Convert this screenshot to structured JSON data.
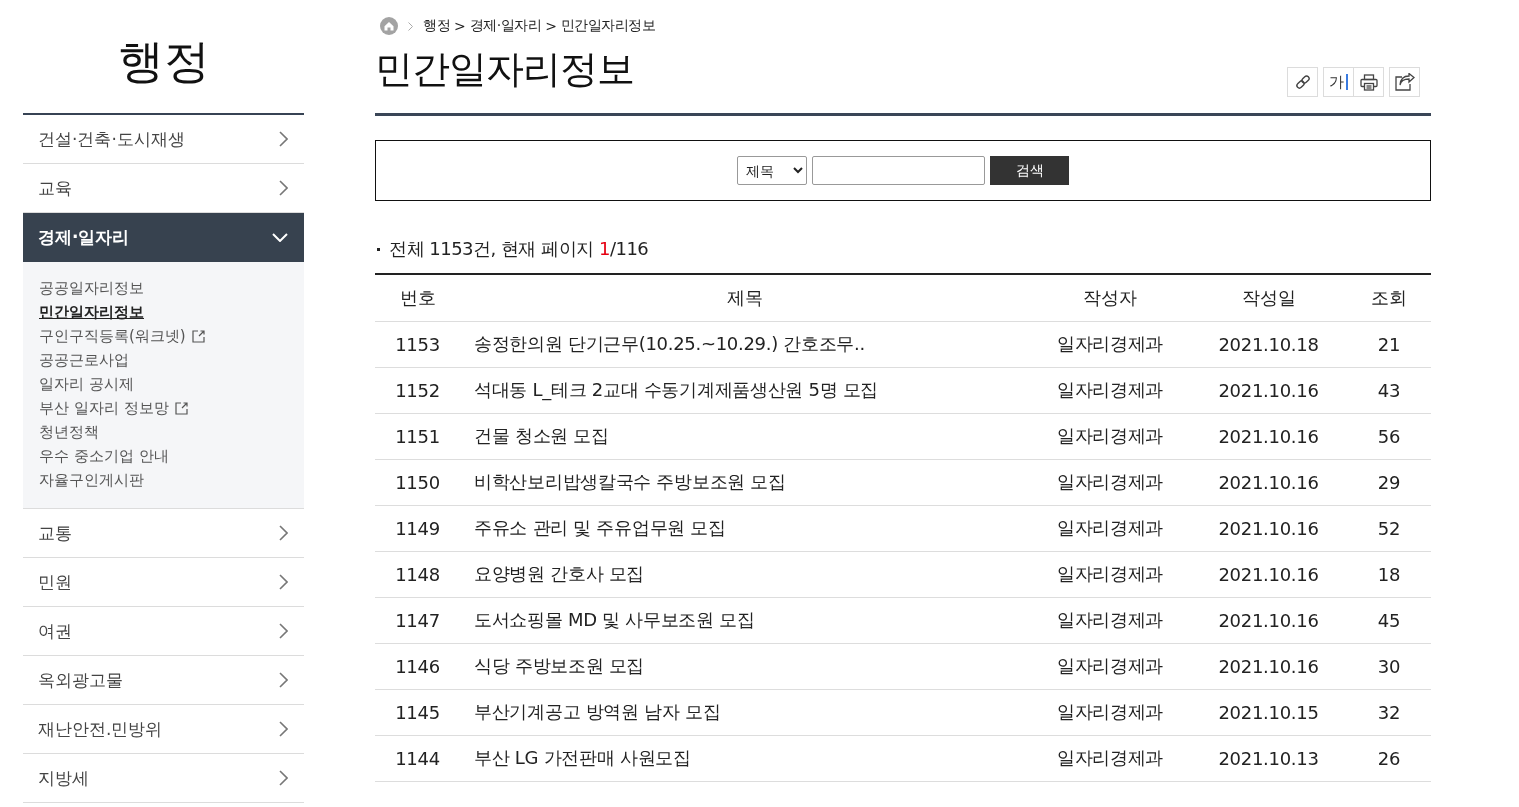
{
  "sidebar": {
    "title": "행정",
    "items": [
      {
        "label": "건설·건축·도시재생",
        "expanded": false
      },
      {
        "label": "교육",
        "expanded": false
      },
      {
        "label": "경제·일자리",
        "expanded": true,
        "children": [
          {
            "label": "공공일자리정보",
            "selected": false,
            "external_link": false
          },
          {
            "label": "민간일자리정보",
            "selected": true,
            "external_link": false
          },
          {
            "label": "구인구직등록(워크넷)",
            "selected": false,
            "external_link": true
          },
          {
            "label": "공공근로사업",
            "selected": false,
            "external_link": false
          },
          {
            "label": "일자리 공시제",
            "selected": false,
            "external_link": false
          },
          {
            "label": "부산 일자리 정보망",
            "selected": false,
            "external_link": true
          },
          {
            "label": "청년정책",
            "selected": false,
            "external_link": false
          },
          {
            "label": "우수 중소기업 안내",
            "selected": false,
            "external_link": false
          },
          {
            "label": "자율구인게시판",
            "selected": false,
            "external_link": false
          }
        ]
      },
      {
        "label": "교통",
        "expanded": false
      },
      {
        "label": "민원",
        "expanded": false
      },
      {
        "label": "여권",
        "expanded": false
      },
      {
        "label": "옥외광고물",
        "expanded": false
      },
      {
        "label": "재난안전.민방위",
        "expanded": false
      },
      {
        "label": "지방세",
        "expanded": false
      }
    ]
  },
  "breadcrumb": [
    {
      "kind": "home"
    },
    {
      "kind": "link",
      "text": "행정"
    },
    {
      "kind": "separator",
      "text": ">"
    },
    {
      "kind": "link",
      "text": "경제·일자리"
    },
    {
      "kind": "separator",
      "text": ">"
    },
    {
      "kind": "link",
      "text": "민간일자리정보"
    }
  ],
  "page_title": "민간일자리정보",
  "tools": [
    {
      "kind": "link"
    },
    {
      "kind": "font_size",
      "label": "가"
    },
    {
      "kind": "print"
    },
    {
      "kind": "share"
    }
  ],
  "search": {
    "field": "제목",
    "button": "검색"
  },
  "summary": {
    "text": "전체 1153건, 현재 페이지",
    "current_page": "1",
    "page_total": "/116"
  },
  "table": {
    "columns": [
      "번호",
      "제목",
      "작성자",
      "작성일",
      "조회"
    ],
    "rows": [
      {
        "number": "1153",
        "title": "송정한의원 단기근무(10.25.~10.29.) 간호조무..",
        "author": "일자리경제과",
        "date": "2021.10.18",
        "views": "21"
      },
      {
        "number": "1152",
        "title": "석대동 L_테크 2교대 수동기계제품생산원 5명 모집",
        "author": "일자리경제과",
        "date": "2021.10.16",
        "views": "43"
      },
      {
        "number": "1151",
        "title": "건물 청소원 모집",
        "author": "일자리경제과",
        "date": "2021.10.16",
        "views": "56"
      },
      {
        "number": "1150",
        "title": "비학산보리밥생칼국수 주방보조원 모집",
        "author": "일자리경제과",
        "date": "2021.10.16",
        "views": "29"
      },
      {
        "number": "1149",
        "title": "주유소 관리 및 주유업무원 모집",
        "author": "일자리경제과",
        "date": "2021.10.16",
        "views": "52"
      },
      {
        "number": "1148",
        "title": "요양병원 간호사 모집",
        "author": "일자리경제과",
        "date": "2021.10.16",
        "views": "18"
      },
      {
        "number": "1147",
        "title": "도서쇼핑몰 MD 및 사무보조원 모집",
        "author": "일자리경제과",
        "date": "2021.10.16",
        "views": "45"
      },
      {
        "number": "1146",
        "title": "식당 주방보조원 모집",
        "author": "일자리경제과",
        "date": "2021.10.16",
        "views": "30"
      },
      {
        "number": "1145",
        "title": "부산기계공고 방역원 남자 모집",
        "author": "일자리경제과",
        "date": "2021.10.15",
        "views": "32"
      },
      {
        "number": "1144",
        "title": "부산 LG 가전판매 사원모집",
        "author": "일자리경제과",
        "date": "2021.10.13",
        "views": "26"
      }
    ]
  }
}
